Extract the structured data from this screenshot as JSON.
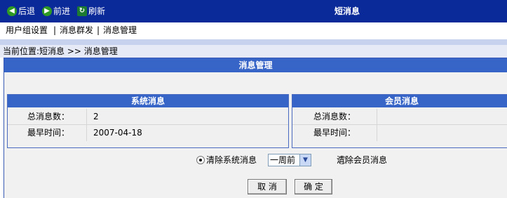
{
  "toolbar": {
    "back_label": "后退",
    "forward_label": "前进",
    "refresh_label": "刷新",
    "title": "短消息"
  },
  "menu": {
    "items": [
      "用户组设置",
      "消息群发",
      "消息管理"
    ],
    "separator": "|"
  },
  "location": {
    "text": "当前位置:短消息 >> 消息管理"
  },
  "main": {
    "title": "消息管理",
    "system_panel": {
      "title": "系统消息",
      "total_label": "总消息数：",
      "total_value": "2",
      "earliest_label": "最早时间：",
      "earliest_value": "2007-04-18"
    },
    "member_panel": {
      "title": "会员消息",
      "total_label": "总消息数：",
      "total_value": "",
      "earliest_label": "最早时间：",
      "earliest_value": ""
    },
    "options": {
      "clear_system_label": "清除系统消息",
      "clear_system_checked": true,
      "period_selected": "一周前",
      "clear_member_label": "清除会员消息",
      "clear_member_checked": false
    },
    "buttons": {
      "cancel": "取 消",
      "confirm": "确 定"
    }
  },
  "colors": {
    "toolbar_bg": "#0b2a9a",
    "header_bg": "#3764c7",
    "location_bg": "#e6eaf7",
    "panel_bg": "#f0f0f0"
  }
}
